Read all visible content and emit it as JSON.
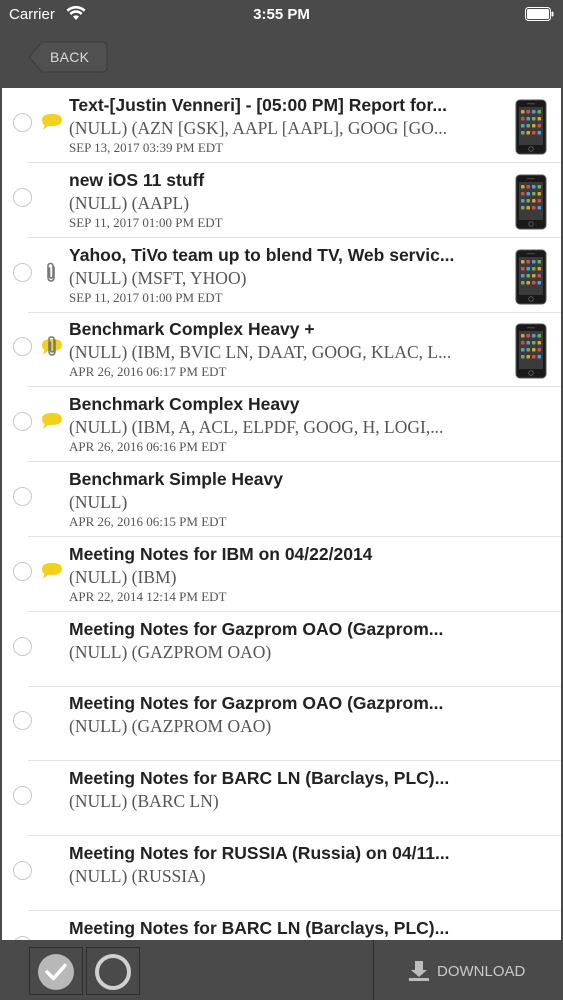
{
  "status_bar": {
    "carrier": "Carrier",
    "time": "3:55 PM"
  },
  "nav": {
    "back_label": "BACK"
  },
  "items": [
    {
      "title": "Text-[Justin Venneri] - [05:00 PM] Report for...",
      "subtitle": "(NULL) (AZN [GSK], AAPL [AAPL], GOOG [GO...",
      "date": "SEP 13, 2017 03:39 PM EDT",
      "icon": "comment-icon",
      "device": true
    },
    {
      "title": "new iOS 11 stuff",
      "subtitle": "(NULL) (AAPL)",
      "date": "SEP 11, 2017 01:00 PM EDT",
      "icon": "",
      "device": true
    },
    {
      "title": "Yahoo, TiVo team up to blend TV, Web servic...",
      "subtitle": "(NULL) (MSFT, YHOO)",
      "date": "SEP 11, 2017 01:00 PM EDT",
      "icon": "paperclip-icon",
      "device": true
    },
    {
      "title": "Benchmark Complex Heavy +",
      "subtitle": "(NULL) (IBM, BVIC LN, DAAT, GOOG, KLAC, L...",
      "date": "APR 26, 2016 06:17 PM EDT",
      "icon": "comment-attachment-icon",
      "device": true
    },
    {
      "title": "Benchmark Complex Heavy",
      "subtitle": "(NULL) (IBM, A, ACL, ELPDF, GOOG, H, LOGI,...",
      "date": "APR 26, 2016 06:16 PM EDT",
      "icon": "comment-icon",
      "device": false
    },
    {
      "title": "Benchmark Simple Heavy",
      "subtitle": "(NULL)",
      "date": "APR 26, 2016 06:15 PM EDT",
      "icon": "",
      "device": false
    },
    {
      "title": "Meeting Notes for IBM on 04/22/2014",
      "subtitle": "(NULL) (IBM)",
      "date": "APR 22, 2014 12:14 PM EDT",
      "icon": "comment-icon",
      "device": false
    },
    {
      "title": "Meeting Notes for Gazprom OAO (Gazprom...",
      "subtitle": "(NULL) (GAZPROM OAO)",
      "date": "",
      "icon": "",
      "device": false
    },
    {
      "title": "Meeting Notes for Gazprom OAO (Gazprom...",
      "subtitle": "(NULL) (GAZPROM OAO)",
      "date": "",
      "icon": "",
      "device": false
    },
    {
      "title": "Meeting Notes for BARC LN (Barclays, PLC)...",
      "subtitle": "(NULL) (BARC LN)",
      "date": "",
      "icon": "",
      "device": false
    },
    {
      "title": "Meeting Notes for RUSSIA (Russia) on 04/11...",
      "subtitle": "(NULL) (RUSSIA)",
      "date": "",
      "icon": "",
      "device": false
    },
    {
      "title": "Meeting Notes for BARC LN (Barclays, PLC)...",
      "subtitle": "",
      "date": "",
      "icon": "",
      "device": false
    }
  ],
  "toolbar": {
    "download_label": "DOWNLOAD"
  },
  "colors": {
    "chrome": "#4a4a4a",
    "comment": "#f2d020",
    "list_bg": "#ffffff"
  }
}
